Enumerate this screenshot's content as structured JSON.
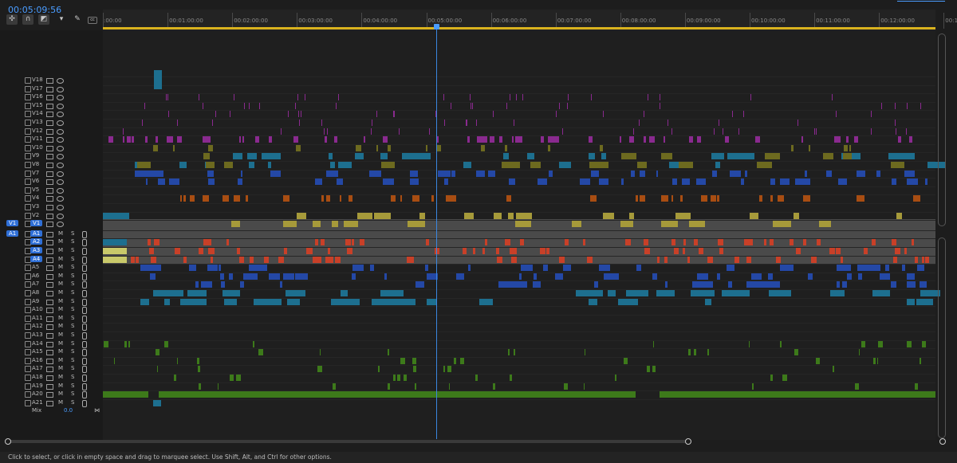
{
  "timecode": "00:05:09:56",
  "tools": [
    "snap-icon",
    "link-icon",
    "add-marker-icon",
    "marker-icon",
    "wrench-icon",
    "captions-icon"
  ],
  "ruler": {
    "labels": [
      ":00:00",
      "00:01:00:00",
      "00:02:00:00",
      "00:03:00:00",
      "00:04:00:00",
      "00:05:00:00",
      "00:06:00:00",
      "00:07:00:00",
      "00:08:00:00",
      "00:09:00:00",
      "00:10:00:00",
      "00:11:00:00",
      "00:12:00:00",
      "00:13"
    ]
  },
  "source_patch": {
    "video": "V1",
    "audio": "A1"
  },
  "video_tracks": [
    "V18",
    "V17",
    "V16",
    "V15",
    "V14",
    "V13",
    "V12",
    "V11",
    "V10",
    "V9",
    "V8",
    "V7",
    "V6",
    "V5",
    "V4",
    "V3",
    "V2",
    "V1"
  ],
  "audio_tracks": [
    "A1",
    "A2",
    "A3",
    "A4",
    "A5",
    "A6",
    "A7",
    "A8",
    "A9",
    "A10",
    "A11",
    "A12",
    "A13",
    "A14",
    "A15",
    "A16",
    "A17",
    "A18",
    "A19",
    "A20",
    "A21"
  ],
  "mute_label": "M",
  "solo_label": "S",
  "mix": {
    "label": "Mix",
    "value": "0.0"
  },
  "colors": {
    "accent": "#4a9cff",
    "cyan": "#1d6f8f",
    "blue": "#2448a6",
    "purple": "#8a2a8f",
    "olive": "#6d6a1f",
    "yellow": "#a69a3a",
    "orange": "#a84d12",
    "green": "#3d7a1a",
    "red": "#c84028"
  },
  "status": "Click to select, or click in empty space and drag to marquee select. Use Shift, Alt, and Ctrl for other options."
}
